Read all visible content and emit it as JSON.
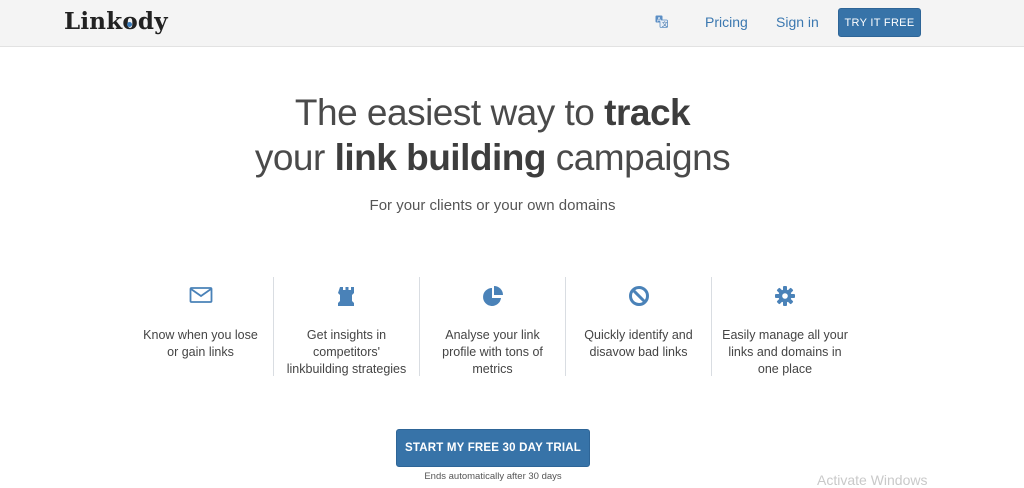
{
  "header": {
    "logo": "Linkody",
    "lang_icon": "translate-icon",
    "nav": [
      {
        "label": "Pricing"
      },
      {
        "label": "Sign in"
      }
    ],
    "cta_label": "TRY IT FREE"
  },
  "hero": {
    "title_line1_pre": "The easiest way to ",
    "title_line1_bold": "track",
    "title_line2_pre": "your ",
    "title_line2_bold": "link building",
    "title_line2_post": " campaigns",
    "subtitle": "For your clients or your own domains"
  },
  "features": [
    {
      "icon": "envelope-icon",
      "text": "Know when you lose or gain links"
    },
    {
      "icon": "rook-icon",
      "text": "Get insights in competitors' linkbuilding strategies"
    },
    {
      "icon": "pie-chart-icon",
      "text": "Analyse your link profile with tons of metrics"
    },
    {
      "icon": "ban-icon",
      "text": "Quickly identify and disavow bad links"
    },
    {
      "icon": "gear-icon",
      "text": "Easily manage all your links and domains in one place"
    }
  ],
  "cta": {
    "label": "START MY FREE 30 DAY TRIAL",
    "note": "Ends automatically after 30 days"
  },
  "watermark": "Activate Windows",
  "colors": {
    "accent": "#3773a8",
    "icon": "#4a82b8",
    "topbar": "#f4f4f4"
  }
}
